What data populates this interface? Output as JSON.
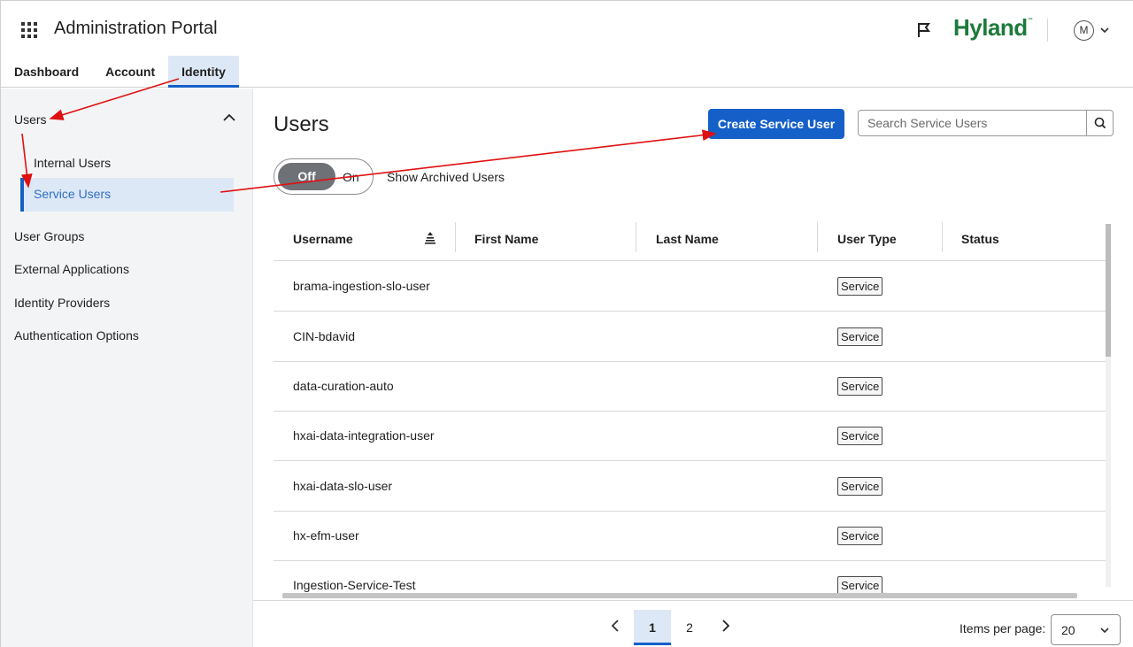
{
  "header": {
    "app_title": "Administration Portal",
    "brand": "Hyland",
    "brand_mark": "™",
    "avatar_initial": "M",
    "icons": [
      "apps-grid-icon",
      "flag-icon",
      "chevron-down-icon"
    ]
  },
  "tabs": [
    {
      "label": "Dashboard",
      "active": false
    },
    {
      "label": "Account",
      "active": false
    },
    {
      "label": "Identity",
      "active": true
    }
  ],
  "sidebar": {
    "section_label": "Users",
    "sub_items": [
      {
        "label": "Internal Users",
        "active": false
      },
      {
        "label": "Service Users",
        "active": true
      }
    ],
    "items": [
      {
        "label": "User Groups"
      },
      {
        "label": "External Applications"
      },
      {
        "label": "Identity Providers"
      },
      {
        "label": "Authentication Options"
      }
    ]
  },
  "main": {
    "title": "Users",
    "create_button": "Create Service User",
    "search_placeholder": "Search Service Users",
    "toggle": {
      "off_label": "Off",
      "on_label": "On",
      "state": "Off"
    },
    "toggle_label": "Show Archived Users"
  },
  "table": {
    "columns": [
      "Username",
      "First Name",
      "Last Name",
      "User Type",
      "Status"
    ],
    "rows": [
      {
        "username": "brama-ingestion-slo-user",
        "first_name": "",
        "last_name": "",
        "user_type": "Service",
        "status": ""
      },
      {
        "username": "CIN-bdavid",
        "first_name": "",
        "last_name": "",
        "user_type": "Service",
        "status": ""
      },
      {
        "username": "data-curation-auto",
        "first_name": "",
        "last_name": "",
        "user_type": "Service",
        "status": ""
      },
      {
        "username": "hxai-data-integration-user",
        "first_name": "",
        "last_name": "",
        "user_type": "Service",
        "status": ""
      },
      {
        "username": "hxai-data-slo-user",
        "first_name": "",
        "last_name": "",
        "user_type": "Service",
        "status": ""
      },
      {
        "username": "hx-efm-user",
        "first_name": "",
        "last_name": "",
        "user_type": "Service",
        "status": ""
      },
      {
        "username": "Ingestion-Service-Test",
        "first_name": "",
        "last_name": "",
        "user_type": "Service",
        "status": ""
      }
    ]
  },
  "pagination": {
    "pages": [
      "1",
      "2"
    ],
    "current": "1",
    "items_per_page_label": "Items per page:",
    "items_per_page_value": "20"
  },
  "colors": {
    "accent": "#1560c8",
    "brand": "#1d7a3a",
    "active_bg": "#dde8f6",
    "annotation_arrow": "#e01010"
  }
}
